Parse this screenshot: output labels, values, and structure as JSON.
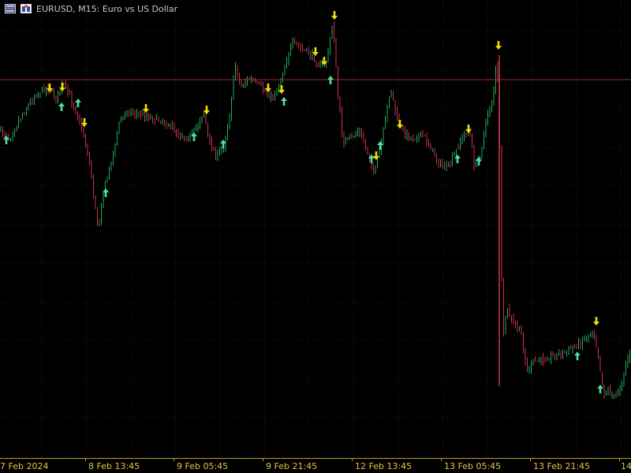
{
  "window": {
    "symbol_title": "EURUSD, M15:  Euro vs US Dollar",
    "toolbar_icons": [
      "order-book-icon",
      "one-click-trading-icon"
    ]
  },
  "time_axis": {
    "labels": [
      "7 Feb 2024",
      "8 Feb 13:45",
      "9 Feb 05:45",
      "9 Feb 21:45",
      "12 Feb 13:45",
      "13 Feb 05:45",
      "13 Feb 21:45",
      "14"
    ]
  },
  "colors": {
    "background": "#000000",
    "grid": "#1c1c1c",
    "bull_candle": "#1fae5a",
    "bear_candle": "#c8324e",
    "level_line": "#a32a3a",
    "buy_arrow": "#4ee0a0",
    "sell_arrow": "#f0e000",
    "axis": "#b8a22a",
    "axis_text": "#e6c34a"
  },
  "indicators": {
    "horizontal_level": "price level line",
    "buy_signal_icon": "up-arrow-icon",
    "sell_signal_icon": "down-arrow-icon"
  }
}
